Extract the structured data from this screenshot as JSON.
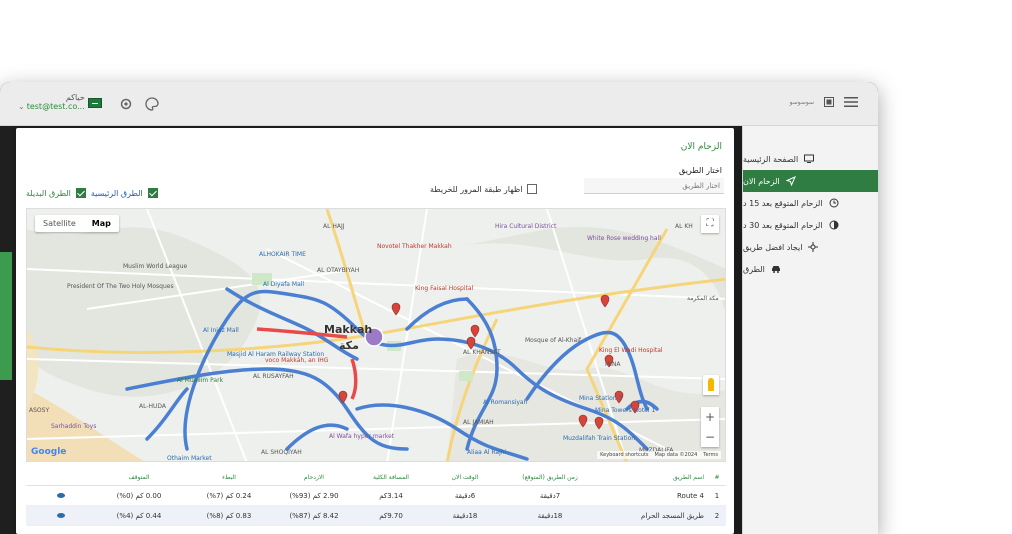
{
  "user": {
    "name": "حياكم",
    "email": "test@test.co..."
  },
  "topbar": {
    "logo_text": "ﺳﻮﺳﻮﺳﻮ"
  },
  "sidebar": {
    "items": [
      {
        "label": "الصفحة الرئيسية",
        "icon": "monitor-icon"
      },
      {
        "label": "الزحام الان",
        "icon": "send-icon",
        "active": true
      },
      {
        "label": "الزحام المتوقع بعد 15 د",
        "icon": "clock-icon"
      },
      {
        "label": "الزحام المتوقع بعد 30 د",
        "icon": "half-circle-icon"
      },
      {
        "label": "ايجاد افضل طريق",
        "icon": "route-icon"
      },
      {
        "label": "الطرق",
        "icon": "car-icon"
      }
    ]
  },
  "panel": {
    "title": "الزحام الان",
    "choose_label": "اختار الطريق",
    "choose_placeholder": "اختار الطريق",
    "traffic_toggle": "اظهار طبقة المرور للخريطة",
    "legend_main": "الطرق الرئيسية",
    "legend_alt": "الطرق البديلة"
  },
  "map": {
    "tabs": [
      "Satellite",
      "Map"
    ],
    "active_tab": "Map",
    "fullscreen_symbol": "⛶",
    "zoom_in": "+",
    "zoom_out": "−",
    "google": "Google",
    "footer": [
      "Keyboard shortcuts",
      "Map data ©2024",
      "Terms"
    ],
    "labels": {
      "makkah_en": "Makkah",
      "makkah_ar": "مكة",
      "al_hajj": "AL HAJJ",
      "hira": "Hira Cultural District",
      "white_rose": "White Rose wedding hall",
      "novotel": "Novotel Thakher Makkah",
      "hokair": "ALHOKAIR TIME",
      "al_otaybiyah": "AL OTAYBIYAH",
      "king_faisal": "King Faisal Hospital",
      "muslim_league": "Muslim World League",
      "two_holy": "President Of The Two Holy Mosques",
      "diyafa": "Al Diyafa Mall",
      "ajyad": "Ajyad St",
      "al_injaz": "Al Injaz Mall",
      "masjid_haram": "Masjid Al Haram Railway Station",
      "voco": "voco Makkah, an IHG",
      "aziziyah": "AL AZIZIYAH",
      "al_muallim": "Al Muallim Park",
      "al_huda": "AL-HUDA",
      "al_uzaziyah": "AL RUSAYFAH",
      "sarhaddin": "Sarhaddin Toys",
      "othaim": "Othaim Market",
      "al_shoqiyah": "AL SHOQIYAH",
      "wafa": "Al Wafa hyper market",
      "kakiyah": "Kakiyah Makkah",
      "al_jamiah": "AL JAMIAH",
      "al_rajhi": "Aliaa Al Rajhi",
      "mosque_khaif": "Mosque of Al-Khaif",
      "mina": "MINA",
      "mina_station": "Mina Station 3",
      "mina_tower": "Mina Towers Hotel 1",
      "wadi_hospital": "King El Wadi Hospital",
      "muzdalifa_station": "Muzdalifah Train Station",
      "muzdalifa": "MUZDALIFA",
      "al_romansiyah": "Al Romansiyah",
      "rawdah": "AL RAWDAH",
      "sulaymaniyah": "AL KHANSAT",
      "asosy": "ASOSY",
      "al_jaz": "AL KH",
      "makkah_ar_right": "مكة المكرمة"
    }
  },
  "table": {
    "headers": [
      "#",
      "اسم الطريق",
      "زمن الطريق (المتوقع)",
      "الوقت الان",
      "المسافة الكلية",
      "الازدحام",
      "البطء",
      "المتوقف",
      ""
    ],
    "rows": [
      {
        "idx": "1",
        "name": "Route 4",
        "traffic": "7دقيقة",
        "time": "6دقيقة",
        "dist": "3.14كم",
        "ratio": "2.90 كم (93%)",
        "slow": "0.24 كم (7%)",
        "stop": "0.00 كم (0%)"
      },
      {
        "idx": "2",
        "name": "طريق المسجد الحرام",
        "traffic": "18دقيقة",
        "time": "18دقيقة",
        "dist": "9.70كم",
        "ratio": "8.42 كم (87%)",
        "slow": "0.83 كم (8%)",
        "stop": "0.44 كم (4%)"
      }
    ]
  },
  "colors": {
    "accent": "#2f7d43",
    "route_blue": "#4a7fd1",
    "route_red": "#e84a4a",
    "pin": "#d6453a"
  }
}
